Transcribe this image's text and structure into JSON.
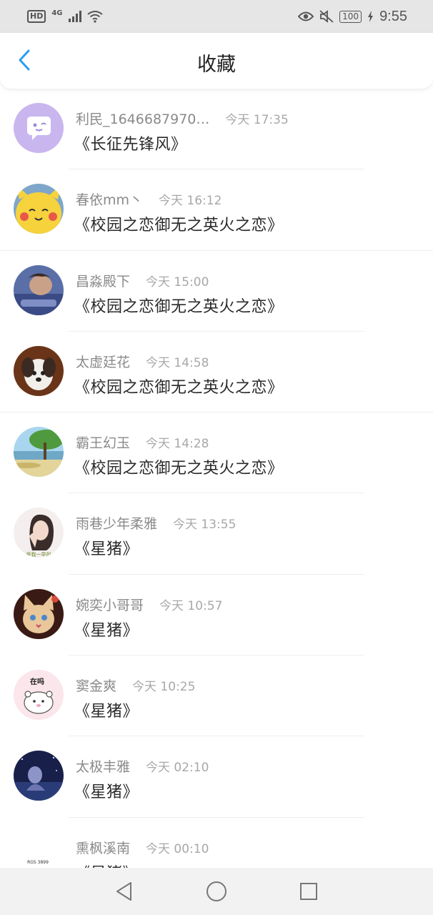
{
  "status_bar": {
    "hd_label": "HD",
    "network_label": "4G",
    "battery": "100",
    "time": "9:55"
  },
  "header": {
    "title": "收藏",
    "back_icon": "chevron-left-icon",
    "accent_color": "#2a9df4"
  },
  "favorites": [
    {
      "username": "利民_1646687970…",
      "time": "今天 17:35",
      "book": "《长征先锋风》"
    },
    {
      "username": "春依mm丶",
      "time": "今天 16:12",
      "book": "《校园之恋御无之英火之恋》"
    },
    {
      "username": "昌淼殿下",
      "time": "今天 15:00",
      "book": "《校园之恋御无之英火之恋》"
    },
    {
      "username": "太虚廷花",
      "time": "今天 14:58",
      "book": "《校园之恋御无之英火之恋》"
    },
    {
      "username": "霸王幻玉",
      "time": "今天 14:28",
      "book": "《校园之恋御无之英火之恋》"
    },
    {
      "username": "雨巷少年柔雅",
      "time": "今天 13:55",
      "book": "《星猪》"
    },
    {
      "username": "婉奕小哥哥",
      "time": "今天 10:57",
      "book": "《星猪》"
    },
    {
      "username": "窦金爽",
      "time": "今天 10:25",
      "book": "《星猪》"
    },
    {
      "username": "太极丰雅",
      "time": "今天 02:10",
      "book": "《星猪》"
    },
    {
      "username": "熏枫溪南",
      "time": "今天 00:10",
      "book": "《星猪》"
    }
  ],
  "avatars": {
    "sticker_text": "在吗",
    "photo_caption": "是我一早的",
    "partial_text": "RGS 3899"
  },
  "nav_bar": {
    "back": "triangle-back-icon",
    "home": "circle-home-icon",
    "recents": "square-recents-icon"
  }
}
